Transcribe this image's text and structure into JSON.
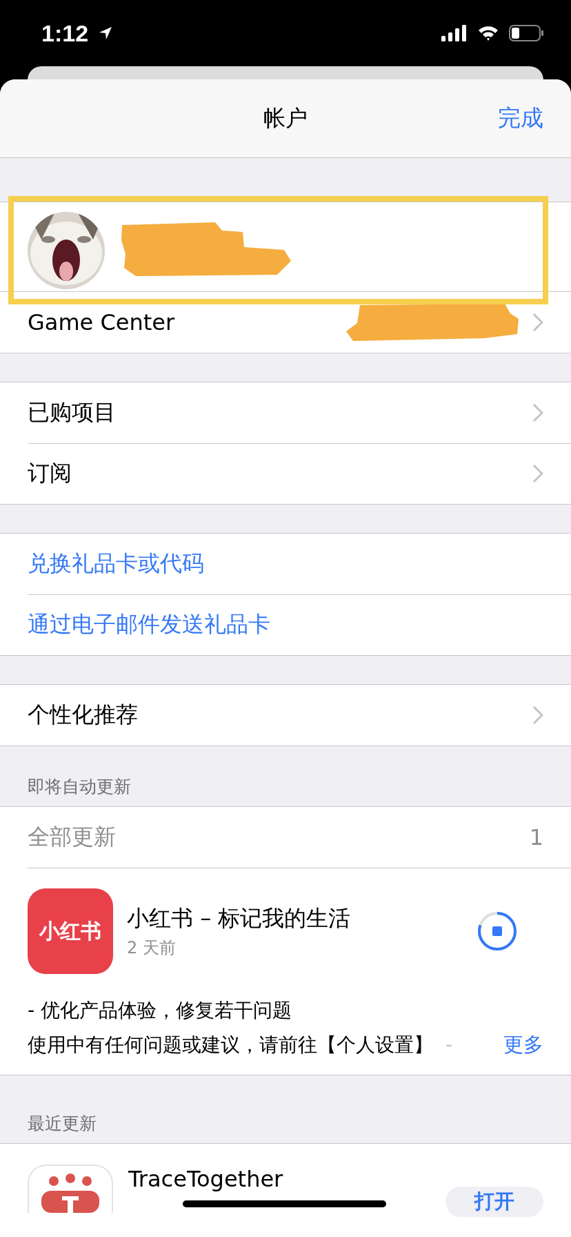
{
  "status_bar": {
    "time": "1:12"
  },
  "nav": {
    "title": "帐户",
    "done": "完成"
  },
  "profile": {
    "highlighted": true
  },
  "game_center": {
    "label": "Game Center"
  },
  "groups": [
    [
      {
        "label": "已购项目",
        "kind": "nav"
      },
      {
        "label": "订阅",
        "kind": "nav"
      }
    ],
    [
      {
        "label": "兑换礼品卡或代码",
        "kind": "link"
      },
      {
        "label": "通过电子邮件发送礼品卡",
        "kind": "link"
      }
    ],
    [
      {
        "label": "个性化推荐",
        "kind": "nav"
      }
    ]
  ],
  "pending": {
    "header": "即将自动更新",
    "update_all": "全部更新",
    "count": "1",
    "app": {
      "icon_text": "小红书",
      "name": "小红书 – 标记我的生活",
      "age": "2 天前",
      "notes": [
        "- 优化产品体验，修复若干问题",
        "使用中有任何问题或建议，请前往【个人设置】"
      ],
      "fade": "-",
      "more": "更多"
    }
  },
  "recent": {
    "header": "最近更新",
    "app": {
      "name": "TraceTogether",
      "button": "打开"
    }
  }
}
